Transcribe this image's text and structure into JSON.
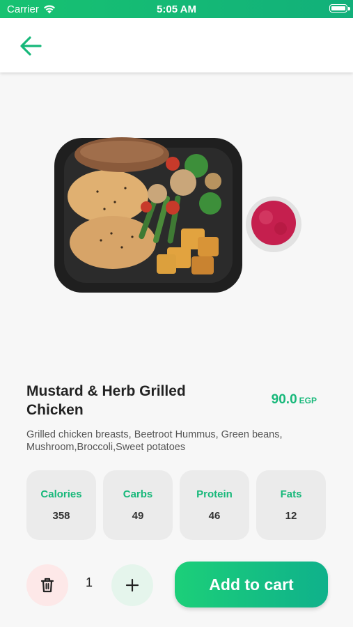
{
  "status_bar": {
    "carrier": "Carrier",
    "time": "5:05 AM"
  },
  "product": {
    "title": "Mustard & Herb Grilled Chicken",
    "price": "90.0",
    "currency": "EGP",
    "description": "Grilled chicken breasts, Beetroot Hummus, Green beans, Mushroom,Broccoli,Sweet potatoes"
  },
  "nutrition": [
    {
      "label": "Calories",
      "value": "358"
    },
    {
      "label": "Carbs",
      "value": "49"
    },
    {
      "label": "Protein",
      "value": "46"
    },
    {
      "label": "Fats",
      "value": "12"
    }
  ],
  "cart": {
    "quantity": "1",
    "add_label": "Add to cart"
  },
  "icons": {
    "back": "arrow-left-icon",
    "delete": "trash-icon",
    "add": "plus-icon"
  },
  "colors": {
    "accent": "#17b87a",
    "delete_bg": "#fde8e8",
    "plus_bg": "#e5f5ec"
  }
}
